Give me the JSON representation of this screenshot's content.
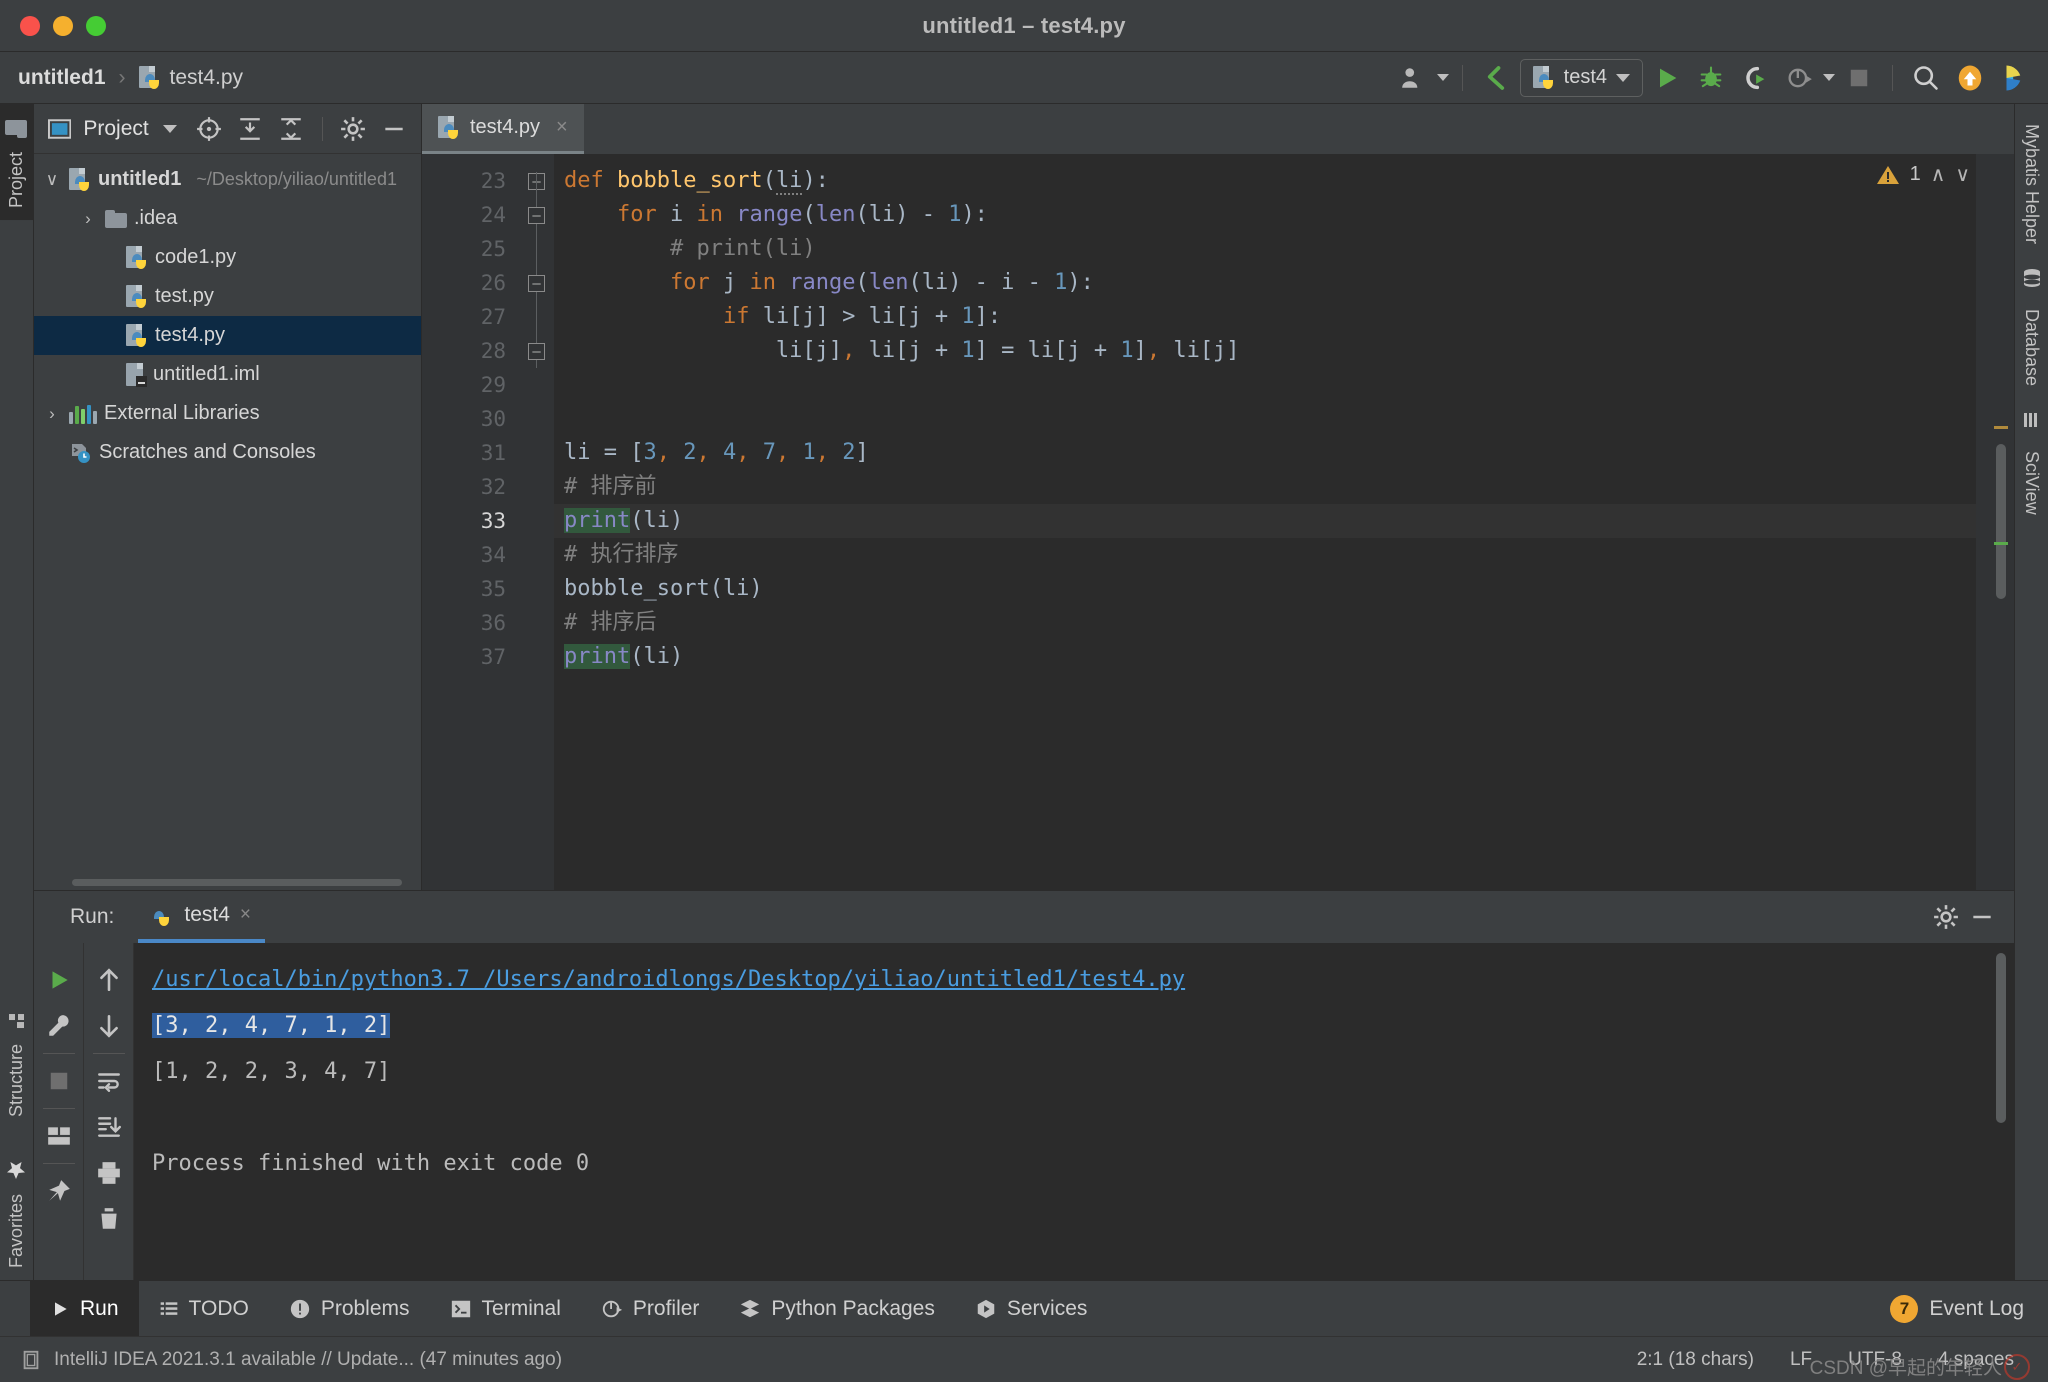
{
  "window": {
    "title": "untitled1 – test4.py",
    "traffic_lights": [
      "close-button",
      "minimize-button",
      "maximize-button"
    ]
  },
  "navbar": {
    "breadcrumb": {
      "project": "untitled1",
      "separator": "›",
      "file": "test4.py"
    },
    "run_config": {
      "label": "test4"
    },
    "buttons": [
      {
        "name": "account-icon",
        "label": ""
      },
      {
        "name": "update-project-icon",
        "label": ""
      },
      {
        "name": "run-button",
        "label": ""
      },
      {
        "name": "debug-button",
        "label": ""
      },
      {
        "name": "run-coverage-button",
        "label": ""
      },
      {
        "name": "profile-button",
        "label": ""
      },
      {
        "name": "stop-button",
        "label": ""
      },
      {
        "name": "search-icon",
        "label": ""
      },
      {
        "name": "updates-icon",
        "label": ""
      },
      {
        "name": "feedback-icon",
        "label": ""
      }
    ]
  },
  "left_strip": {
    "tabs": [
      {
        "label": "Project",
        "name": "sidebar-tab-project",
        "active": true
      },
      {
        "label": "Structure",
        "name": "sidebar-tab-structure",
        "active": false
      },
      {
        "label": "Favorites",
        "name": "sidebar-tab-favorites",
        "active": false
      }
    ]
  },
  "right_strip": {
    "tabs": [
      {
        "label": "Mybatis Helper",
        "name": "sidebar-tab-mybatis-helper"
      },
      {
        "label": "Database",
        "name": "sidebar-tab-database"
      },
      {
        "label": "SciView",
        "name": "sidebar-tab-sciview"
      }
    ]
  },
  "project_panel": {
    "title": "Project",
    "toolbar": [
      {
        "name": "locate-icon"
      },
      {
        "name": "expand-all-icon"
      },
      {
        "name": "collapse-all-icon"
      },
      {
        "name": "gear-icon"
      },
      {
        "name": "hide-icon"
      }
    ],
    "tree": [
      {
        "label": "untitled1",
        "path": "~/Desktop/yiliao/untitled1",
        "icon": "python-project-icon",
        "twist": "∨",
        "depth": 0,
        "bold": true,
        "selected": false
      },
      {
        "label": ".idea",
        "path": "",
        "icon": "folder-icon",
        "twist": "›",
        "depth": 1,
        "bold": false,
        "selected": false
      },
      {
        "label": "code1.py",
        "path": "",
        "icon": "python-file-icon",
        "twist": "",
        "depth": 2,
        "bold": false,
        "selected": false
      },
      {
        "label": "test.py",
        "path": "",
        "icon": "python-file-icon",
        "twist": "",
        "depth": 2,
        "bold": false,
        "selected": false
      },
      {
        "label": "test4.py",
        "path": "",
        "icon": "python-file-icon",
        "twist": "",
        "depth": 2,
        "bold": false,
        "selected": true
      },
      {
        "label": "untitled1.iml",
        "path": "",
        "icon": "iml-file-icon",
        "twist": "",
        "depth": 2,
        "bold": false,
        "selected": false
      },
      {
        "label": "External Libraries",
        "path": "",
        "icon": "libraries-icon",
        "twist": "›",
        "depth": 0,
        "bold": false,
        "selected": false
      },
      {
        "label": "Scratches and Consoles",
        "path": "",
        "icon": "scratches-icon",
        "twist": "",
        "depth": 0,
        "bold": false,
        "selected": false
      }
    ]
  },
  "editor": {
    "tab": {
      "label": "test4.py",
      "close": "×"
    },
    "warning_count": "1",
    "first_line_number": 23,
    "current_line": 33,
    "lines": [
      {
        "n": 23,
        "tokens": [
          {
            "t": "def ",
            "c": "kw"
          },
          {
            "t": "bobble_sort",
            "c": "fn"
          },
          {
            "t": "(",
            "c": "op"
          },
          {
            "t": "li",
            "c": "squig"
          },
          {
            "t": "):",
            "c": "op"
          }
        ]
      },
      {
        "n": 24,
        "tokens": [
          {
            "t": "    ",
            "c": "op"
          },
          {
            "t": "for",
            "c": "kw"
          },
          {
            "t": " i ",
            "c": "op"
          },
          {
            "t": "in",
            "c": "kw"
          },
          {
            "t": " ",
            "c": "op"
          },
          {
            "t": "range",
            "c": "bi"
          },
          {
            "t": "(",
            "c": "op"
          },
          {
            "t": "len",
            "c": "bi"
          },
          {
            "t": "(li) - ",
            "c": "op"
          },
          {
            "t": "1",
            "c": "num"
          },
          {
            "t": "):",
            "c": "op"
          }
        ]
      },
      {
        "n": 25,
        "tokens": [
          {
            "t": "        # print(li)",
            "c": "cm"
          }
        ]
      },
      {
        "n": 26,
        "tokens": [
          {
            "t": "        ",
            "c": "op"
          },
          {
            "t": "for",
            "c": "kw"
          },
          {
            "t": " j ",
            "c": "op"
          },
          {
            "t": "in",
            "c": "kw"
          },
          {
            "t": " ",
            "c": "op"
          },
          {
            "t": "range",
            "c": "bi"
          },
          {
            "t": "(",
            "c": "op"
          },
          {
            "t": "len",
            "c": "bi"
          },
          {
            "t": "(li) - i - ",
            "c": "op"
          },
          {
            "t": "1",
            "c": "num"
          },
          {
            "t": "):",
            "c": "op"
          }
        ]
      },
      {
        "n": 27,
        "tokens": [
          {
            "t": "            ",
            "c": "op"
          },
          {
            "t": "if",
            "c": "kw"
          },
          {
            "t": " li[j] > li[j + ",
            "c": "op"
          },
          {
            "t": "1",
            "c": "num"
          },
          {
            "t": "]:",
            "c": "op"
          }
        ]
      },
      {
        "n": 28,
        "tokens": [
          {
            "t": "                li[j]",
            "c": "op"
          },
          {
            "t": ",",
            "c": "comma"
          },
          {
            "t": " li[j + ",
            "c": "op"
          },
          {
            "t": "1",
            "c": "num"
          },
          {
            "t": "] = li[j + ",
            "c": "op"
          },
          {
            "t": "1",
            "c": "num"
          },
          {
            "t": "]",
            "c": "op"
          },
          {
            "t": ",",
            "c": "comma"
          },
          {
            "t": " li[j]",
            "c": "op"
          }
        ]
      },
      {
        "n": 29,
        "tokens": []
      },
      {
        "n": 30,
        "tokens": []
      },
      {
        "n": 31,
        "tokens": [
          {
            "t": "li = [",
            "c": "op"
          },
          {
            "t": "3",
            "c": "num"
          },
          {
            "t": ",",
            "c": "comma"
          },
          {
            "t": " ",
            "c": "op"
          },
          {
            "t": "2",
            "c": "num"
          },
          {
            "t": ",",
            "c": "comma"
          },
          {
            "t": " ",
            "c": "op"
          },
          {
            "t": "4",
            "c": "num"
          },
          {
            "t": ",",
            "c": "comma"
          },
          {
            "t": " ",
            "c": "op"
          },
          {
            "t": "7",
            "c": "num"
          },
          {
            "t": ",",
            "c": "comma"
          },
          {
            "t": " ",
            "c": "op"
          },
          {
            "t": "1",
            "c": "num"
          },
          {
            "t": ",",
            "c": "comma"
          },
          {
            "t": " ",
            "c": "op"
          },
          {
            "t": "2",
            "c": "num"
          },
          {
            "t": "]",
            "c": "op"
          }
        ]
      },
      {
        "n": 32,
        "tokens": [
          {
            "t": "# 排序前",
            "c": "cm"
          }
        ]
      },
      {
        "n": 33,
        "tokens": [
          {
            "t": "print",
            "c": "bi hl"
          },
          {
            "t": "(li)",
            "c": "op"
          }
        ]
      },
      {
        "n": 34,
        "tokens": [
          {
            "t": "# 执行排序",
            "c": "cm"
          }
        ]
      },
      {
        "n": 35,
        "tokens": [
          {
            "t": "bobble_sort(li)",
            "c": "op"
          }
        ]
      },
      {
        "n": 36,
        "tokens": [
          {
            "t": "# 排序后",
            "c": "cm"
          }
        ]
      },
      {
        "n": 37,
        "tokens": [
          {
            "t": "print",
            "c": "bi hl"
          },
          {
            "t": "(li)",
            "c": "op"
          }
        ]
      }
    ]
  },
  "run_panel": {
    "label": "Run:",
    "tab": {
      "label": "test4",
      "close": "×"
    },
    "header_buttons": [
      {
        "name": "settings-gear-icon"
      },
      {
        "name": "hide-panel-icon"
      }
    ],
    "side_buttons": [
      {
        "name": "rerun-button"
      },
      {
        "name": "edit-configuration-button"
      },
      {
        "name": "stop-button"
      },
      {
        "name": "layout-button"
      },
      {
        "name": "pin-tab-button"
      },
      {
        "name": "scroll-up-button"
      },
      {
        "name": "scroll-down-button"
      },
      {
        "name": "soft-wrap-button"
      },
      {
        "name": "scroll-to-end-button"
      },
      {
        "name": "print-button"
      },
      {
        "name": "clear-all-button"
      }
    ],
    "console": [
      {
        "text": "/usr/local/bin/python3.7 /Users/androidlongs/Desktop/yiliao/untitled1/test4.py",
        "style": "link"
      },
      {
        "text": "[3, 2, 4, 7, 1, 2]",
        "style": "selected"
      },
      {
        "text": "[1, 2, 2, 3, 4, 7]",
        "style": "plain"
      },
      {
        "text": "",
        "style": "plain"
      },
      {
        "text": "Process finished with exit code 0",
        "style": "plain"
      }
    ]
  },
  "bottom_bar": {
    "tabs": [
      {
        "label": "Run",
        "name": "tool-tab-run",
        "icon": "play-icon",
        "active": true
      },
      {
        "label": "TODO",
        "name": "tool-tab-todo",
        "icon": "todo-icon",
        "active": false
      },
      {
        "label": "Problems",
        "name": "tool-tab-problems",
        "icon": "problems-icon",
        "active": false
      },
      {
        "label": "Terminal",
        "name": "tool-tab-terminal",
        "icon": "terminal-icon",
        "active": false
      },
      {
        "label": "Profiler",
        "name": "tool-tab-profiler",
        "icon": "profiler-icon",
        "active": false
      },
      {
        "label": "Python Packages",
        "name": "tool-tab-python-packages",
        "icon": "packages-icon",
        "active": false
      },
      {
        "label": "Services",
        "name": "tool-tab-services",
        "icon": "services-icon",
        "active": false
      }
    ],
    "event_log": {
      "label": "Event Log",
      "badge": "7"
    }
  },
  "status_bar": {
    "message": "IntelliJ IDEA 2021.3.1 available // Update... (47 minutes ago)",
    "caret": "2:1 (18 chars)",
    "line_separator": "LF",
    "encoding": "UTF-8",
    "indent": "4 spaces",
    "watermark": "CSDN @早起的年轻人"
  },
  "colors": {
    "accent_blue": "#4a88c7",
    "selection_blue": "#2f5e9e",
    "tree_selection": "#0d2a44",
    "keyword_orange": "#cc7832",
    "function_yellow": "#ffc66d",
    "number_blue": "#6897bb",
    "builtin_purple": "#8888c6",
    "comment_gray": "#808080",
    "editor_bg": "#2b2b2b",
    "panel_bg": "#3c3f41",
    "search_highlight": "#32593d",
    "badge_orange": "#f0a732"
  }
}
